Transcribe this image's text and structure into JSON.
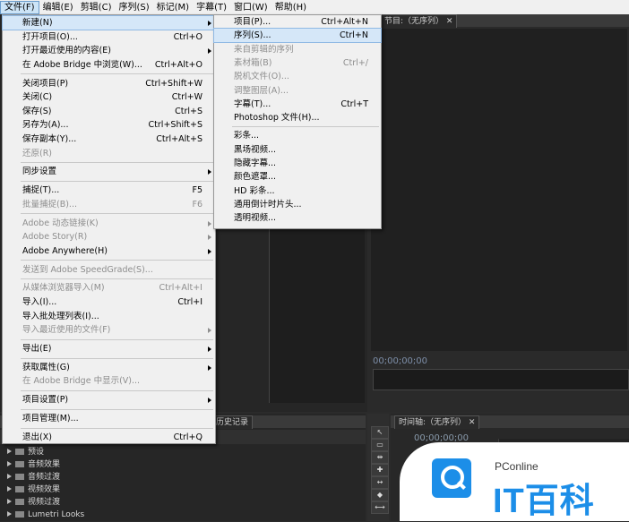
{
  "menubar": [
    "文件(F)",
    "编辑(E)",
    "剪辑(C)",
    "序列(S)",
    "标记(M)",
    "字幕(T)",
    "窗口(W)",
    "帮助(H)"
  ],
  "program_monitor": {
    "title": "节目:（无序列）",
    "timecode": "00;00;00;00"
  },
  "history_tab": "历史记录",
  "timeline": {
    "title": "时间轴:（无序列）",
    "timecode": "00;00;00;00"
  },
  "effects_tree": [
    "预设",
    "音频效果",
    "音频过渡",
    "视频效果",
    "视频过渡",
    "Lumetri Looks"
  ],
  "file_menu": [
    {
      "label": "新建(N)",
      "submenu": true,
      "highlighted": true
    },
    {
      "label": "打开项目(O)...",
      "shortcut": "Ctrl+O"
    },
    {
      "label": "打开最近使用的内容(E)",
      "submenu": true
    },
    {
      "label": "在 Adobe Bridge 中浏览(W)...",
      "shortcut": "Ctrl+Alt+O"
    },
    {
      "sep": true
    },
    {
      "label": "关闭项目(P)",
      "shortcut": "Ctrl+Shift+W"
    },
    {
      "label": "关闭(C)",
      "shortcut": "Ctrl+W"
    },
    {
      "label": "保存(S)",
      "shortcut": "Ctrl+S"
    },
    {
      "label": "另存为(A)...",
      "shortcut": "Ctrl+Shift+S"
    },
    {
      "label": "保存副本(Y)...",
      "shortcut": "Ctrl+Alt+S"
    },
    {
      "label": "还原(R)",
      "disabled": true
    },
    {
      "sep": true
    },
    {
      "label": "同步设置",
      "submenu": true
    },
    {
      "sep": true
    },
    {
      "label": "捕捉(T)...",
      "shortcut": "F5"
    },
    {
      "label": "批量捕捉(B)...",
      "shortcut": "F6",
      "disabled": true
    },
    {
      "sep": true
    },
    {
      "label": "Adobe 动态链接(K)",
      "submenu": true,
      "disabled": true
    },
    {
      "label": "Adobe Story(R)",
      "submenu": true,
      "disabled": true
    },
    {
      "label": "Adobe Anywhere(H)",
      "submenu": true
    },
    {
      "sep": true
    },
    {
      "label": "发送到 Adobe SpeedGrade(S)...",
      "disabled": true
    },
    {
      "sep": true
    },
    {
      "label": "从媒体浏览器导入(M)",
      "shortcut": "Ctrl+Alt+I",
      "disabled": true
    },
    {
      "label": "导入(I)...",
      "shortcut": "Ctrl+I"
    },
    {
      "label": "导入批处理列表(I)..."
    },
    {
      "label": "导入最近使用的文件(F)",
      "submenu": true,
      "disabled": true
    },
    {
      "sep": true
    },
    {
      "label": "导出(E)",
      "submenu": true
    },
    {
      "sep": true
    },
    {
      "label": "获取属性(G)",
      "submenu": true
    },
    {
      "label": "在 Adobe Bridge 中显示(V)...",
      "disabled": true
    },
    {
      "sep": true
    },
    {
      "label": "项目设置(P)",
      "submenu": true
    },
    {
      "sep": true
    },
    {
      "label": "项目管理(M)..."
    },
    {
      "sep": true
    },
    {
      "label": "退出(X)",
      "shortcut": "Ctrl+Q"
    }
  ],
  "new_submenu": [
    {
      "label": "项目(P)...",
      "shortcut": "Ctrl+Alt+N"
    },
    {
      "label": "序列(S)...",
      "shortcut": "Ctrl+N",
      "highlighted": true
    },
    {
      "label": "来自剪辑的序列",
      "disabled": true
    },
    {
      "label": "素材箱(B)",
      "shortcut": "Ctrl+/",
      "disabled": true
    },
    {
      "label": "脱机文件(O)...",
      "disabled": true
    },
    {
      "label": "调整图层(A)...",
      "disabled": true
    },
    {
      "label": "字幕(T)...",
      "shortcut": "Ctrl+T"
    },
    {
      "label": "Photoshop 文件(H)..."
    },
    {
      "sep": true
    },
    {
      "label": "彩条..."
    },
    {
      "label": "黑场视频..."
    },
    {
      "label": "隐藏字幕..."
    },
    {
      "label": "颜色遮罩..."
    },
    {
      "label": "HD 彩条..."
    },
    {
      "label": "通用倒计时片头..."
    },
    {
      "label": "透明视频..."
    }
  ],
  "logo": {
    "small": "PConline",
    "big": "IT百科"
  }
}
